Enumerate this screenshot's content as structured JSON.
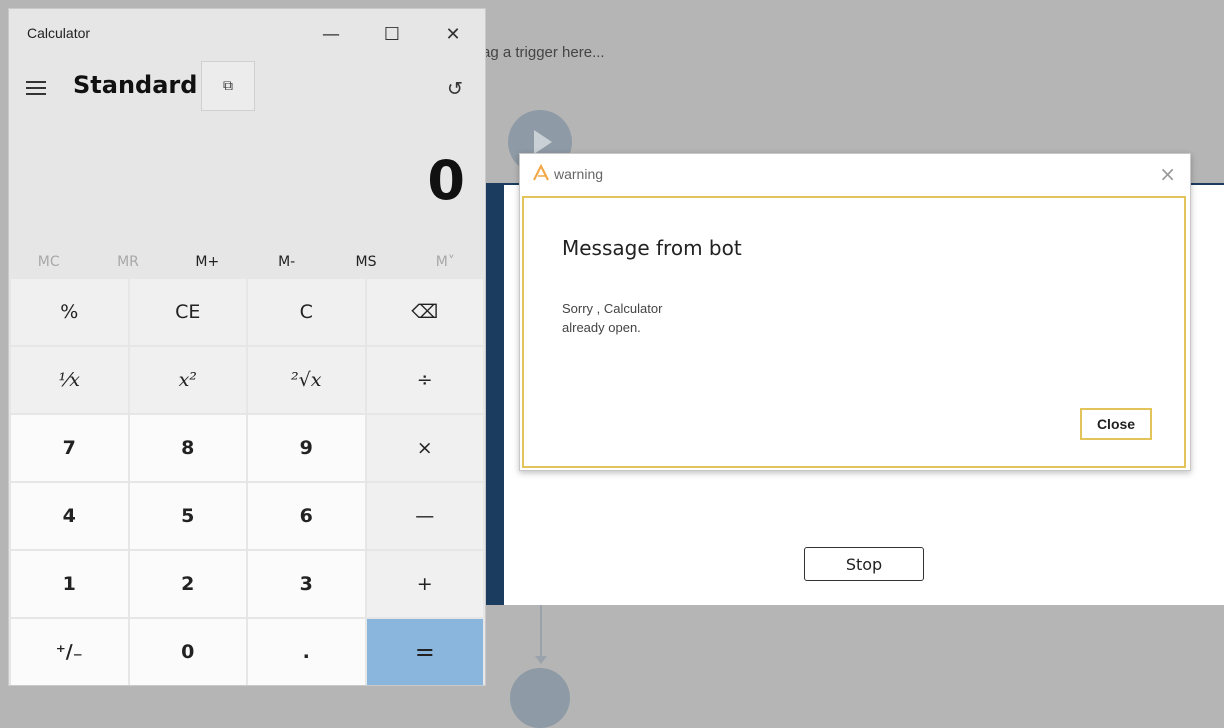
{
  "background": {
    "trigger_hint": "ag a trigger here..."
  },
  "runner": {
    "stop_label": "Stop"
  },
  "warning": {
    "title": "warning",
    "close_glyph": "×",
    "heading": "Message from bot",
    "message_line1": "Sorry , Calculator",
    "message_line2": "already open.",
    "close_label": "Close",
    "accent_color": "#e2c45a",
    "logo_color": "#f2a541"
  },
  "calculator": {
    "title": "Calculator",
    "mode": "Standard",
    "display_value": "0",
    "window_buttons": {
      "minimize": "—",
      "maximize": "☐",
      "close": "✕"
    },
    "keep_on_top_glyph": "⧉",
    "history_glyph": "↺",
    "memory": [
      {
        "label": "MC",
        "enabled": false
      },
      {
        "label": "MR",
        "enabled": false
      },
      {
        "label": "M+",
        "enabled": true
      },
      {
        "label": "M-",
        "enabled": true
      },
      {
        "label": "MS",
        "enabled": true
      },
      {
        "label": "M˅",
        "enabled": false
      }
    ],
    "keys": {
      "percent": "%",
      "ce": "CE",
      "c": "C",
      "backspace": "⌫",
      "reciprocal": "⅟x",
      "square": "x²",
      "sqrt": "²√x",
      "divide": "÷",
      "seven": "7",
      "eight": "8",
      "nine": "9",
      "multiply": "×",
      "four": "4",
      "five": "5",
      "six": "6",
      "minus": "—",
      "one": "1",
      "two": "2",
      "three": "3",
      "plus": "+",
      "negate": "⁺∕₋",
      "zero": "0",
      "decimal": ".",
      "equals": "="
    },
    "equals_color": "#8ab6de"
  }
}
